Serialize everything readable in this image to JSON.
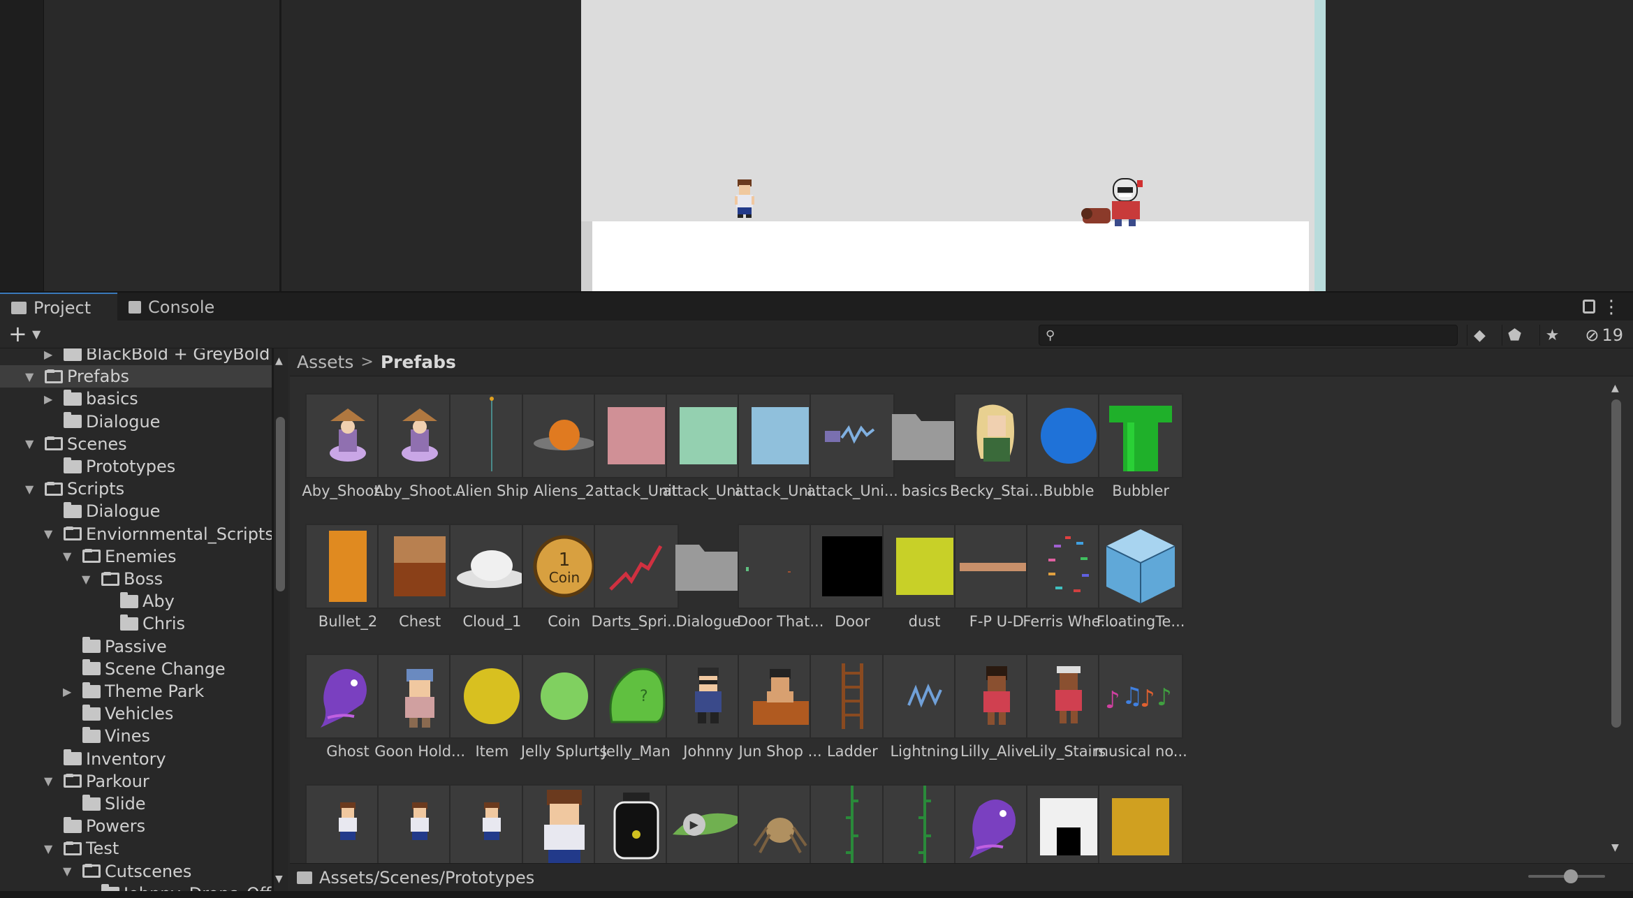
{
  "tabs": {
    "project": "Project",
    "console": "Console"
  },
  "toolbar": {
    "create": "+",
    "search_placeholder": "",
    "hidden_count": "19"
  },
  "breadcrumb": {
    "root": "Assets",
    "separator": ">",
    "current": "Prefabs"
  },
  "tree": [
    {
      "label": "BlackBold + GreyBold For",
      "depth": 1,
      "arrow": "right",
      "open": false
    },
    {
      "label": "Prefabs",
      "depth": 0,
      "arrow": "down",
      "open": true,
      "selected": true
    },
    {
      "label": "basics",
      "depth": 1,
      "arrow": "right",
      "open": false
    },
    {
      "label": "Dialogue",
      "depth": 1,
      "arrow": "",
      "open": false
    },
    {
      "label": "Scenes",
      "depth": 0,
      "arrow": "down",
      "open": true
    },
    {
      "label": "Prototypes",
      "depth": 1,
      "arrow": "",
      "open": false
    },
    {
      "label": "Scripts",
      "depth": 0,
      "arrow": "down",
      "open": true
    },
    {
      "label": "Dialogue",
      "depth": 1,
      "arrow": "",
      "open": false
    },
    {
      "label": "Enviornmental_Scripts",
      "depth": 1,
      "arrow": "down",
      "open": true
    },
    {
      "label": "Enemies",
      "depth": 2,
      "arrow": "down",
      "open": true
    },
    {
      "label": "Boss",
      "depth": 3,
      "arrow": "down",
      "open": true
    },
    {
      "label": "Aby",
      "depth": 4,
      "arrow": "",
      "open": false
    },
    {
      "label": "Chris",
      "depth": 4,
      "arrow": "",
      "open": false
    },
    {
      "label": "Passive",
      "depth": 2,
      "arrow": "",
      "open": false
    },
    {
      "label": "Scene Change",
      "depth": 2,
      "arrow": "",
      "open": false
    },
    {
      "label": "Theme Park",
      "depth": 2,
      "arrow": "right",
      "open": false
    },
    {
      "label": "Vehicles",
      "depth": 2,
      "arrow": "",
      "open": false
    },
    {
      "label": "Vines",
      "depth": 2,
      "arrow": "",
      "open": false
    },
    {
      "label": "Inventory",
      "depth": 1,
      "arrow": "",
      "open": false
    },
    {
      "label": "Parkour",
      "depth": 1,
      "arrow": "down",
      "open": true
    },
    {
      "label": "Slide",
      "depth": 2,
      "arrow": "",
      "open": false
    },
    {
      "label": "Powers",
      "depth": 1,
      "arrow": "",
      "open": false
    },
    {
      "label": "Test",
      "depth": 1,
      "arrow": "down",
      "open": true
    },
    {
      "label": "Cutscenes",
      "depth": 2,
      "arrow": "down",
      "open": true
    },
    {
      "label": "Johnny_Drops_Off",
      "depth": 3,
      "arrow": "",
      "open": false
    }
  ],
  "assets": [
    {
      "label": "Aby_Shoot...",
      "icon": "witch-sprite"
    },
    {
      "label": "Aby_Shoot...",
      "icon": "witch-sprite"
    },
    {
      "label": "Alien Ship",
      "icon": "thin-line"
    },
    {
      "label": "Aliens_2",
      "icon": "orange-ufo"
    },
    {
      "label": "attack_Unit",
      "icon": "pink-square"
    },
    {
      "label": "attack_Uni...",
      "icon": "mint-square"
    },
    {
      "label": "attack_Uni...",
      "icon": "blue-square"
    },
    {
      "label": "attack_Uni...",
      "icon": "zap-sprite"
    },
    {
      "label": "basics",
      "icon": "folder"
    },
    {
      "label": "Becky_Stai...",
      "icon": "blonde-girl"
    },
    {
      "label": "Bubble",
      "icon": "blue-circle"
    },
    {
      "label": "Bubbler",
      "icon": "green-pipe"
    },
    {
      "label": "Bullet_2",
      "icon": "orange-bar"
    },
    {
      "label": "Chest",
      "icon": "chest"
    },
    {
      "label": "Cloud_1",
      "icon": "cloud"
    },
    {
      "label": "Coin",
      "icon": "coin"
    },
    {
      "label": "Darts_Spri...",
      "icon": "red-squiggle"
    },
    {
      "label": "Dialogue",
      "icon": "folder"
    },
    {
      "label": "Door That...",
      "icon": "door-dots"
    },
    {
      "label": "Door",
      "icon": "black-square"
    },
    {
      "label": "dust",
      "icon": "yellow-square"
    },
    {
      "label": "F-P U-D",
      "icon": "plank"
    },
    {
      "label": "Ferris Whe...",
      "icon": "ferris-wheel"
    },
    {
      "label": "FloatingTe...",
      "icon": "cube"
    },
    {
      "label": "Ghost",
      "icon": "ghost"
    },
    {
      "label": "Goon Hold...",
      "icon": "goon"
    },
    {
      "label": "Item",
      "icon": "yellow-circle"
    },
    {
      "label": "Jelly Splurts",
      "icon": "green-circle"
    },
    {
      "label": "Jelly_Man",
      "icon": "jelly-blob"
    },
    {
      "label": "Johnny",
      "icon": "johnny"
    },
    {
      "label": "Jun Shop ...",
      "icon": "shopkeeper"
    },
    {
      "label": "Ladder",
      "icon": "ladder"
    },
    {
      "label": "Lightning",
      "icon": "lightning"
    },
    {
      "label": "Lilly_Alive",
      "icon": "lilly"
    },
    {
      "label": "Lily_Stairs",
      "icon": "lily-cap"
    },
    {
      "label": "musical no...",
      "icon": "music-notes"
    },
    {
      "label": "",
      "icon": "boy-small"
    },
    {
      "label": "",
      "icon": "boy-small"
    },
    {
      "label": "",
      "icon": "boy-small"
    },
    {
      "label": "",
      "icon": "boy-large"
    },
    {
      "label": "",
      "icon": "jar"
    },
    {
      "label": "",
      "icon": "green-leaf"
    },
    {
      "label": "",
      "icon": "spider"
    },
    {
      "label": "",
      "icon": "vine"
    },
    {
      "label": "",
      "icon": "vine"
    },
    {
      "label": "",
      "icon": "ghost"
    },
    {
      "label": "",
      "icon": "white-box"
    },
    {
      "label": "",
      "icon": "gold-square"
    }
  ],
  "status_path": "Assets/Scenes/Prototypes",
  "colors": {
    "accent": "#3a79bb",
    "panel": "#282828",
    "grid": "#2d2d2d",
    "thumb": "#3b3b3b"
  }
}
